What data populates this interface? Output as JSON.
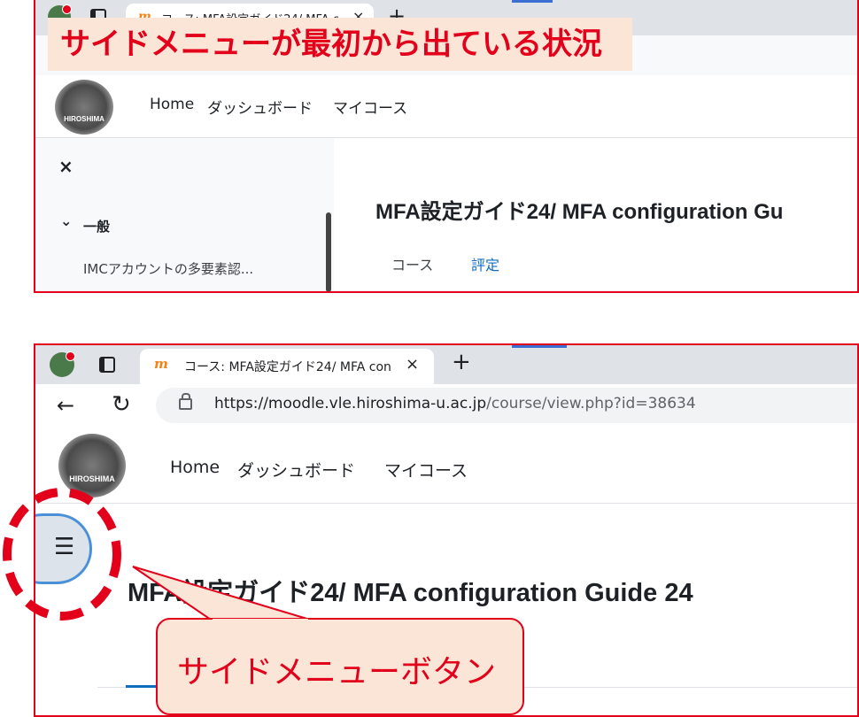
{
  "top": {
    "caption": "サイドメニューが最初から出ている状況",
    "tab_title": "コース: MFA設定ガイド24/ MFA con",
    "tab_close": "×",
    "new_tab": "+",
    "logo_text": "HIROSHIMA",
    "nav": [
      "Home",
      "ダッシュボード",
      "マイコース"
    ],
    "drawer_close": "×",
    "section_toggle": "⌄",
    "section_label": "一般",
    "drawer_item": "IMCアカウントの多要素認...",
    "course_title": "MFA設定ガイド24/ MFA configuration Gu",
    "course_tabs": [
      "コース",
      "評定"
    ]
  },
  "bottom": {
    "tab_title": "コース: MFA設定ガイド24/ MFA con",
    "tab_close": "×",
    "new_tab": "+",
    "back": "←",
    "reload": "↻",
    "url_host": "https://moodle.vle.hiroshima-u.ac.jp",
    "url_path": "/course/view.php?id=38634",
    "logo_text": "HIROSHIMA",
    "nav": [
      "Home",
      "ダッシュボード",
      "マイコース"
    ],
    "menu_icon": "☰",
    "course_title": "MFA設定ガイド24/ MFA configuration Guide 24",
    "callout": "サイドメニューボタン"
  },
  "colors": {
    "frame": "#e2001a",
    "caption_bg": "#fbe5d6",
    "link": "#0f6cbf",
    "drawer_bg": "#f8f9fa",
    "menu_button_border": "#4a90d9"
  }
}
